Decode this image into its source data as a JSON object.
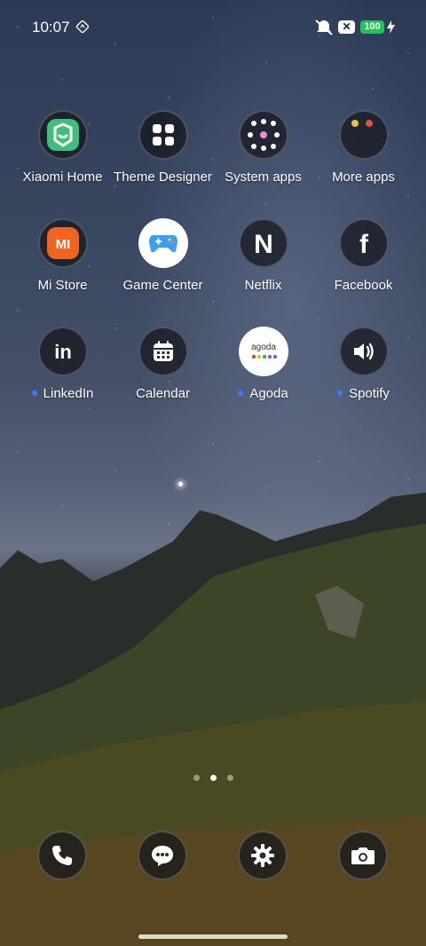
{
  "status_bar": {
    "time": "10:07",
    "notification_badge": "✕",
    "battery": "100"
  },
  "apps": [
    {
      "name": "xiaomi-home",
      "label": "Xiaomi Home",
      "icon": "xiaomi-home-icon",
      "dot": false
    },
    {
      "name": "theme-designer",
      "label": "Theme Designer",
      "icon": "grid-icon",
      "dot": false
    },
    {
      "name": "system-apps",
      "label": "System apps",
      "icon": "folder-icon",
      "dot": false
    },
    {
      "name": "more-apps",
      "label": "More apps",
      "icon": "folder-icon",
      "dot": false
    },
    {
      "name": "mi-store",
      "label": "Mi Store",
      "icon": "mi-store-icon",
      "dot": false
    },
    {
      "name": "game-center",
      "label": "Game Center",
      "icon": "gamepad-icon",
      "dot": false
    },
    {
      "name": "netflix",
      "label": "Netflix",
      "icon": "netflix-icon",
      "dot": false
    },
    {
      "name": "facebook",
      "label": "Facebook",
      "icon": "facebook-icon",
      "dot": false
    },
    {
      "name": "linkedin",
      "label": "LinkedIn",
      "icon": "linkedin-icon",
      "dot": true
    },
    {
      "name": "calendar",
      "label": "Calendar",
      "icon": "calendar-icon",
      "dot": false
    },
    {
      "name": "agoda",
      "label": "Agoda",
      "icon": "agoda-icon",
      "dot": true
    },
    {
      "name": "spotify",
      "label": "Spotify",
      "icon": "speaker-icon",
      "dot": true
    }
  ],
  "agoda_logo_text": "agoda",
  "mi_logo_text": "MI",
  "netflix_logo_text": "N",
  "facebook_logo_text": "f",
  "linkedin_logo_text": "in",
  "page_indicator": {
    "pages": 3,
    "active": 2
  },
  "dock": [
    {
      "name": "dock-phone",
      "icon": "phone-icon"
    },
    {
      "name": "dock-messages",
      "icon": "message-icon"
    },
    {
      "name": "dock-settings",
      "icon": "gear-icon"
    },
    {
      "name": "dock-camera",
      "icon": "camera-icon"
    }
  ],
  "colors": {
    "accent_dot": "#3d7bff",
    "battery": "#22c45a",
    "xiaomi_home": "#3fc07a",
    "mi_store": "#f0641e",
    "game_center": "#3aa0f0"
  }
}
